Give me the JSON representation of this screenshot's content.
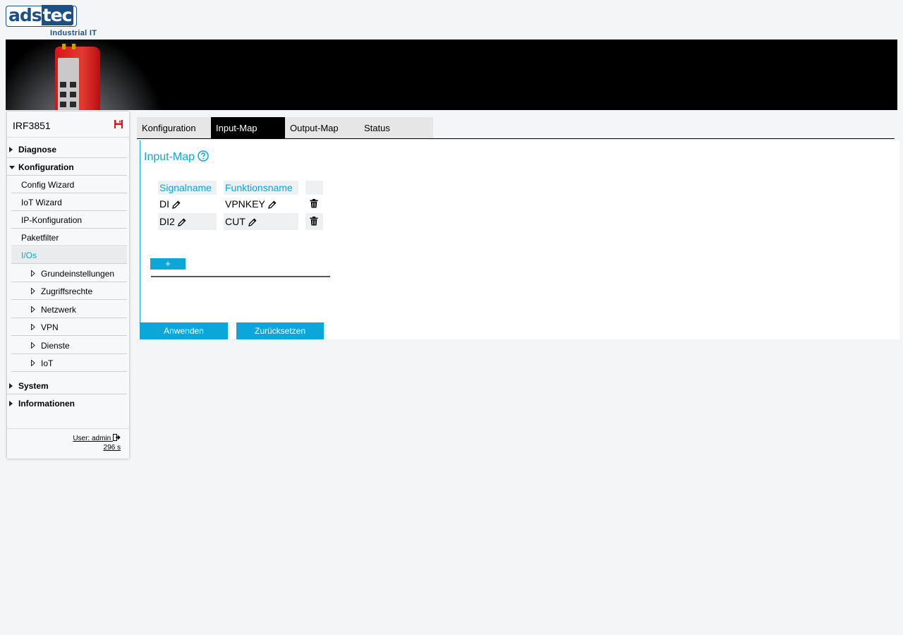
{
  "brand": {
    "logo_text_1": "ads",
    "logo_text_2": "tec",
    "tagline": "Industrial IT"
  },
  "sidebar": {
    "device_name": "IRF3851",
    "items": [
      {
        "label": "Diagnose",
        "expanded": false
      },
      {
        "label": "Konfiguration",
        "expanded": true
      },
      {
        "label": "Config Wizard"
      },
      {
        "label": "IoT Wizard"
      },
      {
        "label": "IP-Konfiguration"
      },
      {
        "label": "Paketfilter"
      },
      {
        "label": "I/Os",
        "active": true
      },
      {
        "label": "Grundeinstellungen"
      },
      {
        "label": "Zugriffsrechte"
      },
      {
        "label": "Netzwerk"
      },
      {
        "label": "VPN"
      },
      {
        "label": "Dienste"
      },
      {
        "label": "IoT"
      },
      {
        "label": "System",
        "expanded": false
      },
      {
        "label": "Informationen",
        "expanded": false
      }
    ],
    "user": "User: admin",
    "timer": "296 s"
  },
  "tabs": [
    {
      "label": "Konfiguration"
    },
    {
      "label": "Input-Map",
      "active": true
    },
    {
      "label": "Output-Map"
    },
    {
      "label": "Status"
    }
  ],
  "section": {
    "title": "Input-Map"
  },
  "table": {
    "headers": [
      "Signalname",
      "Funktionsname"
    ],
    "rows": [
      {
        "signal": "DI",
        "function": "VPNKEY"
      },
      {
        "signal": "DI2",
        "function": "CUT"
      }
    ],
    "add_label": "+"
  },
  "actions": {
    "apply": "Anwenden",
    "reset": "Zurücksetzen"
  },
  "colors": {
    "accent": "#0aa7d8",
    "brand": "#1c4f86",
    "save_icon": "#d7141a"
  }
}
